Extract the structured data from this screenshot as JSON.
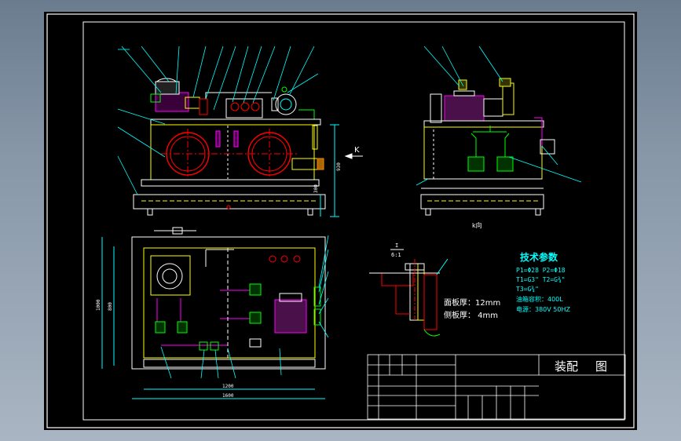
{
  "drawing": {
    "title_block": {
      "drawing_name": "装配图",
      "drawing_name_a": "装配",
      "drawing_name_b": "图"
    },
    "k_arrow_label": "K",
    "k_view_label": "k向",
    "detail_label_top": "I",
    "detail_label_bottom": "6:1",
    "panel_thickness": "面板厚：12mm",
    "side_thickness": "侧板厚： 4mm",
    "tech_params": {
      "heading": "技术参数",
      "line1": "P1=Φ28  P2=Φ18",
      "line2": "T1=G3\"  T2=G¾\"",
      "line3": "T3=G¾\"",
      "line4": "油箱容积：400L",
      "line5": "电源：380V 50HZ"
    },
    "dimensions": {
      "height_total": "930",
      "height_lower": "300",
      "width_inner": "1200",
      "width_outer": "1600",
      "depth_inner": "800",
      "depth_outer": "1000"
    }
  }
}
